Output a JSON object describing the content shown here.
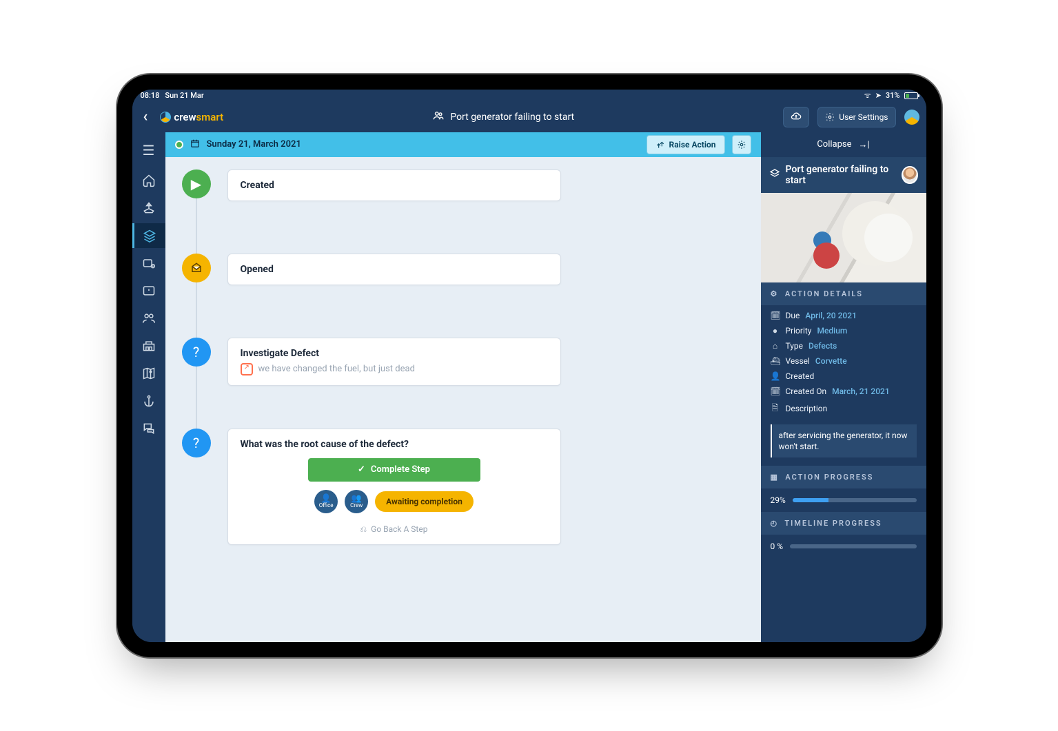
{
  "ios_status": {
    "time": "08:18",
    "date": "Sun 21 Mar",
    "battery_pct": "31%",
    "battery_fill": 31
  },
  "app_header": {
    "brand_crew": "crew",
    "brand_smart": "smart",
    "page_title": "Port generator failing to start",
    "cloud_btn": "",
    "user_settings": "User  Settings"
  },
  "date_bar": {
    "date": "Sunday 21, March 2021",
    "raise_action": "Raise Action"
  },
  "timeline": {
    "created": "Created",
    "opened": "Opened",
    "investigate": {
      "title": "Investigate Defect",
      "note": "we have changed the fuel, but just dead"
    },
    "root_cause": {
      "title": "What was the root cause of the defect?",
      "complete": "Complete Step",
      "role_office": "Office",
      "role_crew": "Crew",
      "awaiting": "Awaiting completion",
      "go_back": "Go Back A Step"
    }
  },
  "right": {
    "collapse": "Collapse",
    "title": "Port generator failing to start",
    "section_details": "ACTION DETAILS",
    "due_l": "Due",
    "due_v": "April, 20 2021",
    "priority_l": "Priority",
    "priority_v": "Medium",
    "type_l": "Type",
    "type_v": "Defects",
    "vessel_l": "Vessel",
    "vessel_v": "Corvette",
    "created_l": "Created",
    "created_on_l": "Created On",
    "created_on_v": "March, 21 2021",
    "description_l": "Description",
    "description_v": "after servicing the generator, it now won't start.",
    "section_action_prog": "ACTION PROGRESS",
    "action_pct_label": "29%",
    "action_pct": 29,
    "section_timeline_prog": "TIMELINE PROGRESS",
    "timeline_pct_label": "0 %",
    "timeline_pct": 0
  }
}
